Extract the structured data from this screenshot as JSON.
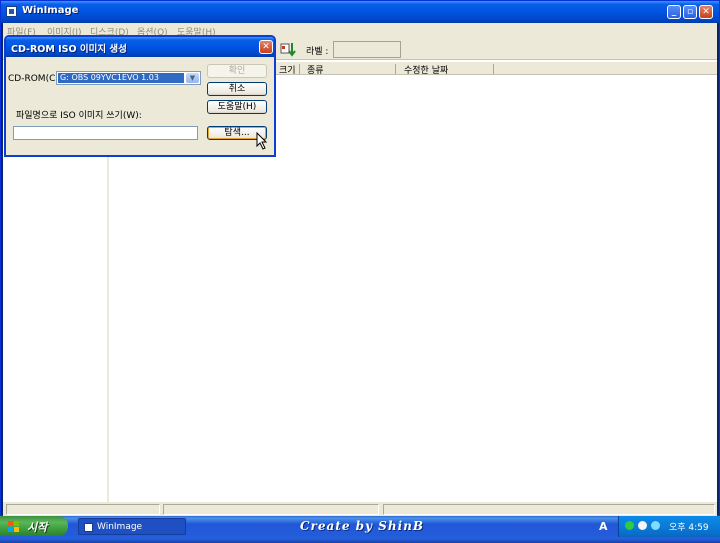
{
  "window": {
    "title": "WinImage"
  },
  "menu": [
    "파일(F)",
    "이미지(I)",
    "디스크(D)",
    "옵션(O)",
    "도움말(H)"
  ],
  "toolbar": {
    "label_text": "라벨 :",
    "label_value": ""
  },
  "list_headers": [
    "크기",
    "종류",
    "수정한 날짜"
  ],
  "dialog": {
    "title": "CD-ROM ISO 이미지 생성",
    "cdrom_label": "CD-ROM(C)",
    "cdrom_selected": "G: OBS 09YVC1EVO 1.03",
    "file_label": "파일명으로 ISO 이미지 쓰기(W):",
    "file_value": "",
    "buttons": {
      "ok": "확인",
      "cancel": "취소",
      "help": "도움말(H)",
      "browse": "탐색..."
    }
  },
  "taskbar": {
    "start_label": "시작",
    "task_label": "WinImage",
    "brand_text": "Create by ShinB",
    "language": "A",
    "clock": "오후 4:59"
  },
  "colors": {
    "titlebar": "#0054e3",
    "face": "#ece9d8",
    "selection": "#316ac5",
    "start": "#3a9a3a"
  }
}
